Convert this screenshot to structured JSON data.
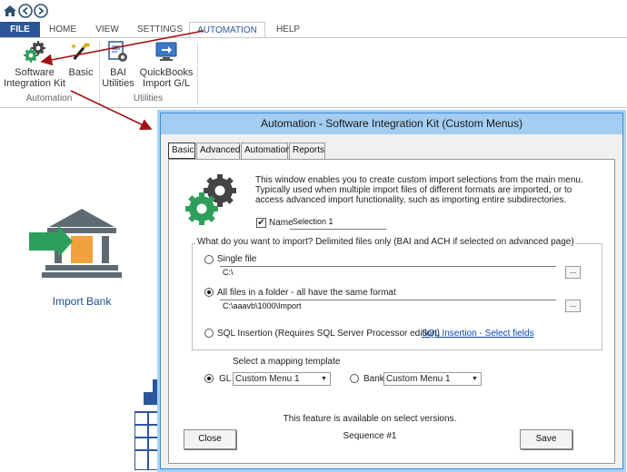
{
  "quick_access": {
    "home_icon": "home-icon",
    "back_icon": "back-icon",
    "forward_icon": "forward-icon"
  },
  "ribbon_tabs": {
    "file": "FILE",
    "home": "HOME",
    "view": "VIEW",
    "settings": "SETTINGS",
    "automation": "AUTOMATION",
    "help": "HELP"
  },
  "ribbon": {
    "software_integration_kit_line1": "Software",
    "software_integration_kit_line2": "Integration Kit",
    "basic": "Basic",
    "automation_group": "Automation",
    "bai_line1": "BAI",
    "bai_line2": "Utilities",
    "qb_line1": "QuickBooks",
    "qb_line2": "Import G/L",
    "utilities_group": "Utilities"
  },
  "background": {
    "import_bank_label": "Import Bank"
  },
  "dialog": {
    "title": "Automation - Software Integration Kit (Custom Menus)",
    "tabs": [
      "Basic",
      "Advanced",
      "Automation",
      "Reports"
    ],
    "description": "This window enables you to create custom import selections from the main menu.  Typically used when multiple import files of different formats are imported, or to access advanced import functionality, such as importing entire subdirectories.",
    "name_label": "Name",
    "name_value": "Selection 1",
    "import_question": "What do you want to import?  Delimited files only (BAI and ACH if selected on advanced page)",
    "single_file_label": "Single file",
    "single_file_value": "C:\\",
    "all_files_label": "All files in a folder - all have the same format",
    "all_files_value": "C:\\aaavb\\1000\\Import",
    "sql_label": "SQL Insertion (Requires SQL Server Processor edition)",
    "sql_link": "SQL Insertion - Select fields",
    "mapping_label": "Select a mapping template",
    "gl_label": "GL",
    "gl_value": "Custom Menu 1",
    "bank_label": "Bank",
    "bank_value": "Custom Menu 1",
    "feature_note": "This feature is available on select versions.",
    "sequence": "Sequence #1",
    "close_button": "Close",
    "save_button": "Save",
    "browse_ellipsis": "..."
  },
  "colors": {
    "file_tab": "#2b579a",
    "title_bar": "#a3cdf1",
    "annotation_arrow": "#a01010",
    "accent_green": "#2e9e5b"
  }
}
